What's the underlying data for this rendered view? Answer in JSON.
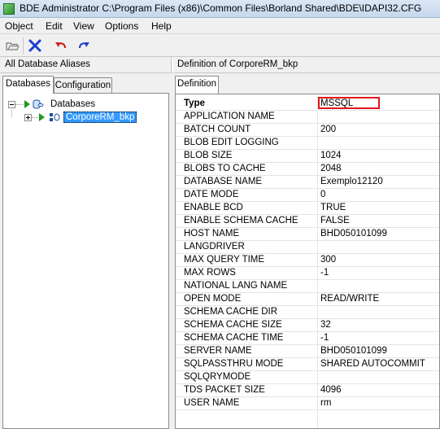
{
  "window": {
    "title": "BDE Administrator  C:\\Program Files (x86)\\Common Files\\Borland Shared\\BDE\\IDAPI32.CFG"
  },
  "menu": [
    "Object",
    "Edit",
    "View",
    "Options",
    "Help"
  ],
  "toolbar": {
    "buttons": [
      {
        "name": "open-icon"
      },
      {
        "name": "delete-icon"
      },
      {
        "name": "undo-icon"
      },
      {
        "name": "redo-icon"
      }
    ]
  },
  "panes": {
    "left_header": "All Database Aliases",
    "right_header": "Definition of CorporeRM_bkp"
  },
  "left_tabs": [
    "Databases",
    "Configuration"
  ],
  "right_tabs": [
    "Definition"
  ],
  "tree": {
    "root": "Databases",
    "children": [
      "CorporeRM_bkp"
    ]
  },
  "properties": [
    {
      "name": "Type",
      "value": "MSSQL",
      "bold": true
    },
    {
      "name": "APPLICATION NAME",
      "value": ""
    },
    {
      "name": "BATCH COUNT",
      "value": "200"
    },
    {
      "name": "BLOB EDIT LOGGING",
      "value": ""
    },
    {
      "name": "BLOB SIZE",
      "value": "1024"
    },
    {
      "name": "BLOBS TO CACHE",
      "value": "2048"
    },
    {
      "name": "DATABASE NAME",
      "value": "Exemplo12120"
    },
    {
      "name": "DATE MODE",
      "value": "0"
    },
    {
      "name": "ENABLE BCD",
      "value": "TRUE"
    },
    {
      "name": "ENABLE SCHEMA CACHE",
      "value": "FALSE"
    },
    {
      "name": "HOST NAME",
      "value": "BHD050101099"
    },
    {
      "name": "LANGDRIVER",
      "value": ""
    },
    {
      "name": "MAX QUERY TIME",
      "value": "300"
    },
    {
      "name": "MAX ROWS",
      "value": "-1"
    },
    {
      "name": "NATIONAL LANG NAME",
      "value": ""
    },
    {
      "name": "OPEN MODE",
      "value": "READ/WRITE"
    },
    {
      "name": "SCHEMA CACHE DIR",
      "value": ""
    },
    {
      "name": "SCHEMA CACHE SIZE",
      "value": "32"
    },
    {
      "name": "SCHEMA CACHE TIME",
      "value": "-1"
    },
    {
      "name": "SERVER NAME",
      "value": "BHD050101099"
    },
    {
      "name": "SQLPASSTHRU MODE",
      "value": "SHARED AUTOCOMMIT"
    },
    {
      "name": "SQLQRYMODE",
      "value": ""
    },
    {
      "name": "TDS PACKET SIZE",
      "value": "4096"
    },
    {
      "name": "USER NAME",
      "value": "rm"
    }
  ],
  "colors": {
    "highlight_box": "#e0141c",
    "selection": "#3399ff"
  }
}
